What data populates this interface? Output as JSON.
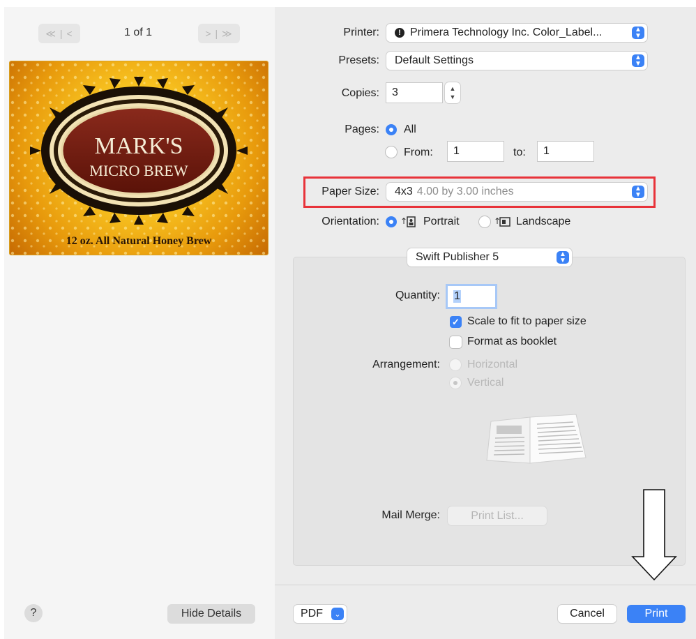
{
  "preview": {
    "first_prev_glyph": "≪ | <",
    "next_last_glyph": "> | ≫",
    "page_counter": "1 of 1",
    "label_line_1": "MARK'S",
    "label_line_2": "MICRO BREW",
    "label_footer": "12 oz. All Natural Honey Brew",
    "help_label": "?",
    "hide_details_label": "Hide Details"
  },
  "settings": {
    "printer_label": "Printer:",
    "printer_value": "Primera Technology Inc. Color_Label...",
    "presets_label": "Presets:",
    "presets_value": "Default Settings",
    "copies_label": "Copies:",
    "copies_value": "3",
    "pages_label": "Pages:",
    "pages_all": "All",
    "pages_from_label": "From:",
    "pages_from_value": "1",
    "pages_to_label": "to:",
    "pages_to_value": "1",
    "paper_size_label": "Paper Size:",
    "paper_size_name": "4x3",
    "paper_size_detail": "4.00 by 3.00 inches",
    "orientation_label": "Orientation:",
    "portrait_label": "Portrait",
    "landscape_label": "Landscape",
    "section_popup": "Swift Publisher 5"
  },
  "app_section": {
    "quantity_label": "Quantity:",
    "quantity_value": "1",
    "scale_to_fit_label": "Scale to fit to paper size",
    "scale_to_fit_checked": true,
    "booklet_label": "Format as booklet",
    "booklet_checked": false,
    "arrangement_label": "Arrangement:",
    "horizontal_label": "Horizontal",
    "vertical_label": "Vertical",
    "mail_merge_label": "Mail Merge:",
    "print_list_label": "Print List..."
  },
  "footer": {
    "pdf_label": "PDF",
    "cancel_label": "Cancel",
    "print_label": "Print"
  },
  "colors": {
    "accent": "#3b82f6",
    "highlight_box": "#e8333a"
  }
}
